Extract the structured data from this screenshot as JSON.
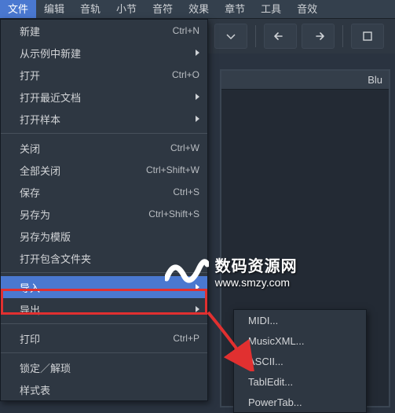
{
  "menubar": {
    "items": [
      {
        "label": "文件",
        "active": true
      },
      {
        "label": "编辑"
      },
      {
        "label": "音轨"
      },
      {
        "label": "小节"
      },
      {
        "label": "音符"
      },
      {
        "label": "效果"
      },
      {
        "label": "章节"
      },
      {
        "label": "工具"
      },
      {
        "label": "音效"
      }
    ]
  },
  "dropdown": {
    "items": [
      {
        "label": "新建",
        "shortcut": "Ctrl+N"
      },
      {
        "label": "从示例中新建",
        "submenu": true
      },
      {
        "label": "打开",
        "shortcut": "Ctrl+O"
      },
      {
        "label": "打开最近文档",
        "submenu": true
      },
      {
        "label": "打开样本",
        "submenu": true
      },
      {
        "sep": true
      },
      {
        "label": "关闭",
        "shortcut": "Ctrl+W"
      },
      {
        "label": "全部关闭",
        "shortcut": "Ctrl+Shift+W"
      },
      {
        "label": "保存",
        "shortcut": "Ctrl+S"
      },
      {
        "label": "另存为",
        "shortcut": "Ctrl+Shift+S"
      },
      {
        "label": "另存为模版"
      },
      {
        "label": "打开包含文件夹"
      },
      {
        "sep": true
      },
      {
        "label": "导入",
        "submenu": true,
        "highlight": true
      },
      {
        "label": "导出",
        "submenu": true
      },
      {
        "sep": true
      },
      {
        "label": "打印",
        "shortcut": "Ctrl+P"
      },
      {
        "sep": true
      },
      {
        "label": "锁定／解琐"
      },
      {
        "label": "样式表"
      }
    ]
  },
  "submenu": {
    "items": [
      {
        "label": "MIDI..."
      },
      {
        "label": "MusicXML..."
      },
      {
        "label": "ASCII..."
      },
      {
        "label": "TablEdit..."
      },
      {
        "label": "PowerTab..."
      }
    ]
  },
  "rightpanel": {
    "header": "Blu"
  },
  "watermark": {
    "cn": "数码资源网",
    "url": "www.smzy.com"
  }
}
